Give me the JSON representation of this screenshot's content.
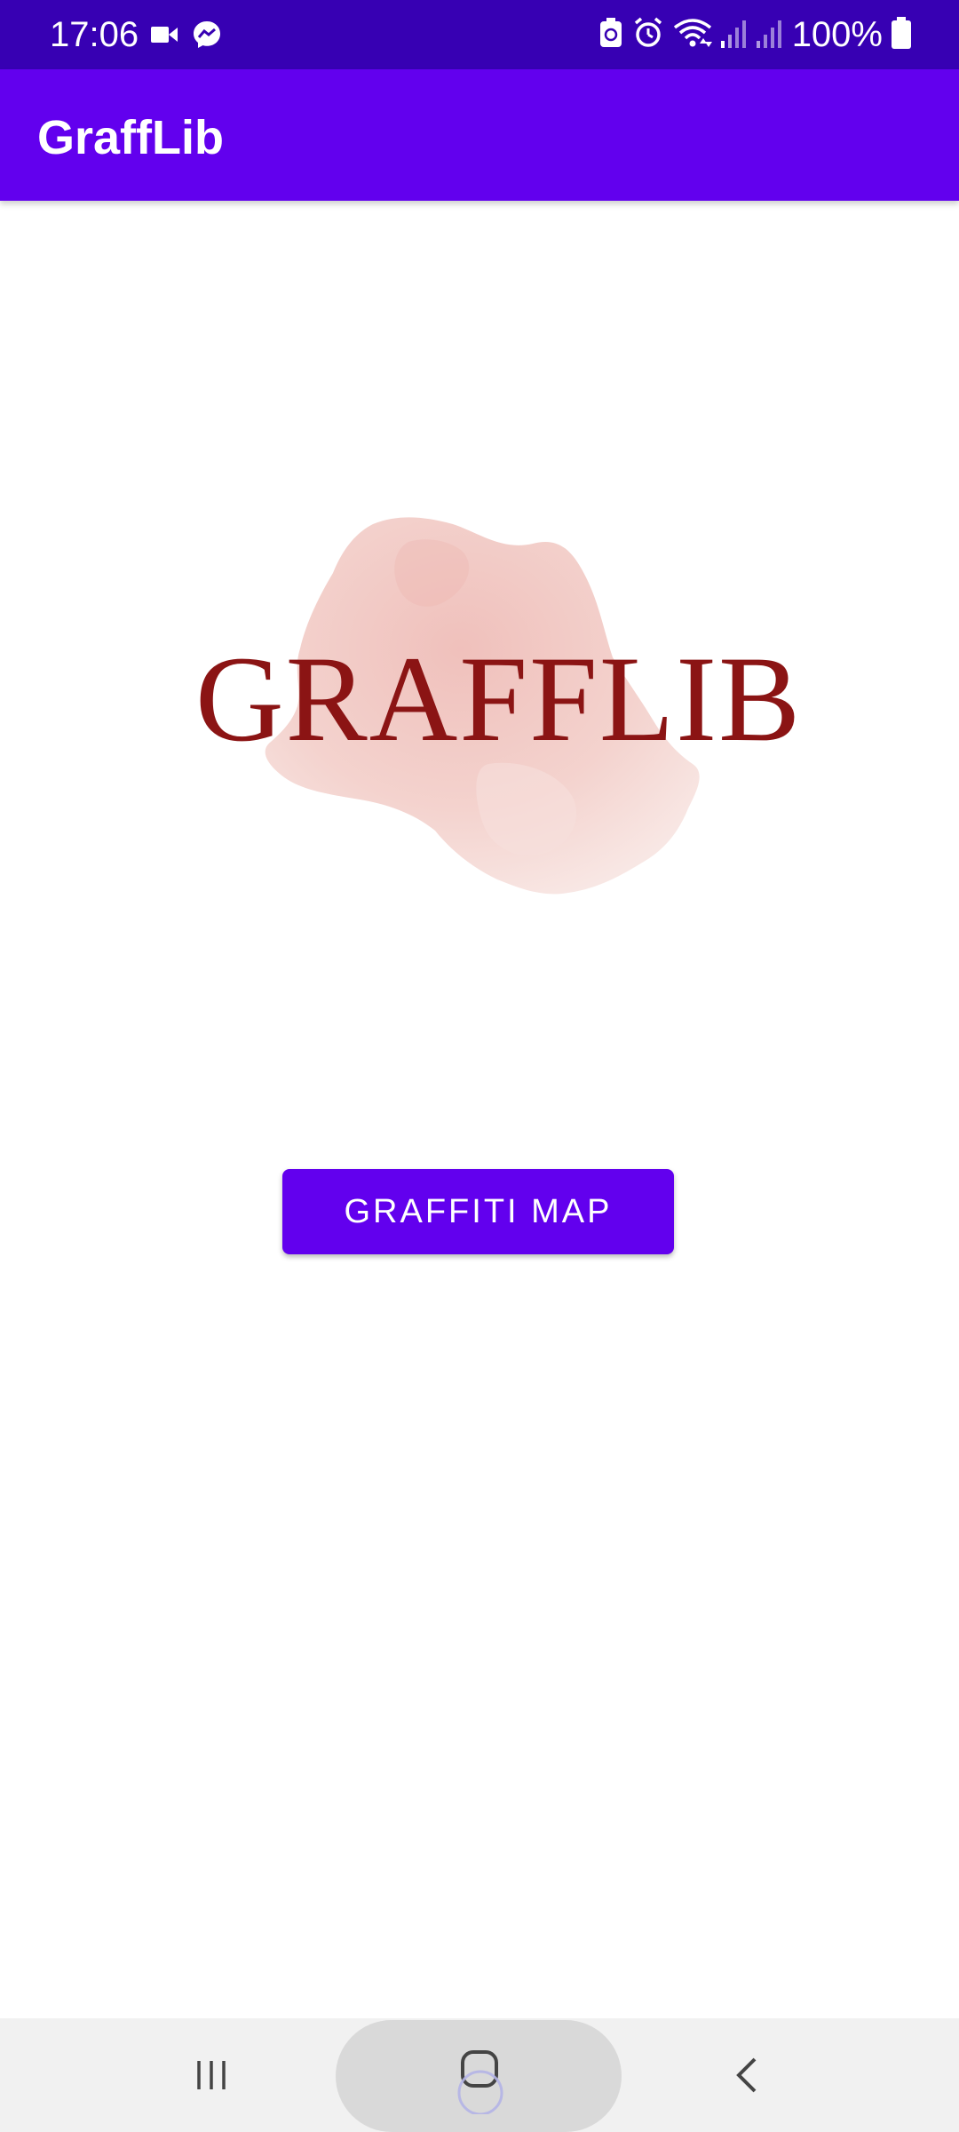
{
  "status_bar": {
    "time": "17:06",
    "left_icons": [
      "video-camera-icon",
      "messenger-icon"
    ],
    "right_icons": [
      "battery-saver-icon",
      "alarm-icon",
      "wifi-icon",
      "signal-icon",
      "signal-icon"
    ],
    "battery_percent": "100%"
  },
  "app_bar": {
    "title": "GraffLib"
  },
  "logo": {
    "text": "GRAFFLIB",
    "text_color": "#8b1414",
    "splash_color": "#f0c4bf"
  },
  "main": {
    "map_button_label": "GRAFFITI MAP"
  },
  "nav_bar": {
    "buttons": [
      "recents-icon",
      "home-icon",
      "back-icon"
    ]
  },
  "colors": {
    "primary": "#6200ee",
    "primary_dark": "#3700b3"
  }
}
